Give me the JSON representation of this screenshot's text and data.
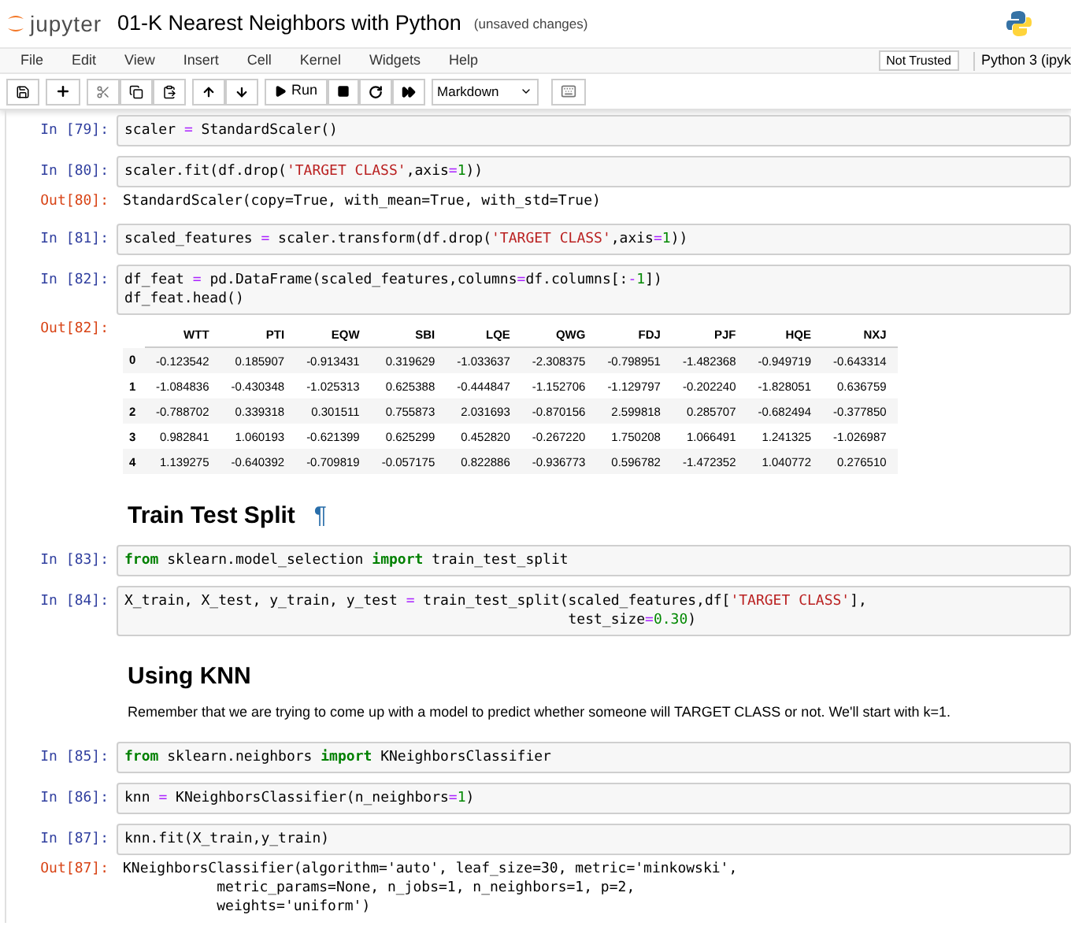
{
  "header": {
    "logo_text": "jupyter",
    "title": "01-K Nearest Neighbors with Python",
    "status": "(unsaved changes)"
  },
  "menu": {
    "items": [
      "File",
      "Edit",
      "View",
      "Insert",
      "Cell",
      "Kernel",
      "Widgets",
      "Help"
    ],
    "trust": "Not Trusted",
    "kernel": "Python 3 (ipyk"
  },
  "toolbar": {
    "run_label": "Run",
    "cell_type": "Markdown"
  },
  "cells": [
    {
      "kind": "code",
      "prompt": "In [79]:",
      "lines": [
        [
          {
            "kind": "plain",
            "t": "scaler "
          },
          {
            "kind": "operator",
            "t": "="
          },
          {
            "kind": "plain",
            "t": " StandardScaler()"
          }
        ]
      ]
    },
    {
      "kind": "code",
      "prompt": "In [80]:",
      "lines": [
        [
          {
            "kind": "plain",
            "t": "scaler.fit(df.drop("
          },
          {
            "kind": "string",
            "t": "'TARGET CLASS'"
          },
          {
            "kind": "plain",
            "t": ",axis"
          },
          {
            "kind": "operator",
            "t": "="
          },
          {
            "kind": "number",
            "t": "1"
          },
          {
            "kind": "plain",
            "t": "))"
          }
        ]
      ]
    },
    {
      "kind": "output",
      "prompt": "Out[80]:",
      "lines": [
        "StandardScaler(copy=True, with_mean=True, with_std=True)"
      ]
    },
    {
      "kind": "code",
      "prompt": "In [81]:",
      "lines": [
        [
          {
            "kind": "plain",
            "t": "scaled_features "
          },
          {
            "kind": "operator",
            "t": "="
          },
          {
            "kind": "plain",
            "t": " scaler.transform(df.drop("
          },
          {
            "kind": "string",
            "t": "'TARGET CLASS'"
          },
          {
            "kind": "plain",
            "t": ",axis"
          },
          {
            "kind": "operator",
            "t": "="
          },
          {
            "kind": "number",
            "t": "1"
          },
          {
            "kind": "plain",
            "t": "))"
          }
        ]
      ]
    },
    {
      "kind": "code",
      "prompt": "In [82]:",
      "lines": [
        [
          {
            "kind": "plain",
            "t": "df_feat "
          },
          {
            "kind": "operator",
            "t": "="
          },
          {
            "kind": "plain",
            "t": " pd.DataFrame(scaled_features,columns"
          },
          {
            "kind": "operator",
            "t": "="
          },
          {
            "kind": "plain",
            "t": "df.columns[:"
          },
          {
            "kind": "operator",
            "t": "-"
          },
          {
            "kind": "number",
            "t": "1"
          },
          {
            "kind": "plain",
            "t": "])"
          }
        ],
        [
          {
            "kind": "plain",
            "t": "df_feat.head()"
          }
        ]
      ]
    },
    {
      "kind": "table",
      "prompt": "Out[82]:",
      "columns": [
        "WTT",
        "PTI",
        "EQW",
        "SBI",
        "LQE",
        "QWG",
        "FDJ",
        "PJF",
        "HQE",
        "NXJ"
      ],
      "rows": [
        {
          "index": "0",
          "cells": [
            "-0.123542",
            "0.185907",
            "-0.913431",
            "0.319629",
            "-1.033637",
            "-2.308375",
            "-0.798951",
            "-1.482368",
            "-0.949719",
            "-0.643314"
          ]
        },
        {
          "index": "1",
          "cells": [
            "-1.084836",
            "-0.430348",
            "-1.025313",
            "0.625388",
            "-0.444847",
            "-1.152706",
            "-1.129797",
            "-0.202240",
            "-1.828051",
            "0.636759"
          ]
        },
        {
          "index": "2",
          "cells": [
            "-0.788702",
            "0.339318",
            "0.301511",
            "0.755873",
            "2.031693",
            "-0.870156",
            "2.599818",
            "0.285707",
            "-0.682494",
            "-0.377850"
          ]
        },
        {
          "index": "3",
          "cells": [
            "0.982841",
            "1.060193",
            "-0.621399",
            "0.625299",
            "0.452820",
            "-0.267220",
            "1.750208",
            "1.066491",
            "1.241325",
            "-1.026987"
          ]
        },
        {
          "index": "4",
          "cells": [
            "1.139275",
            "-0.640392",
            "-0.709819",
            "-0.057175",
            "0.822886",
            "-0.936773",
            "0.596782",
            "-1.472352",
            "1.040772",
            "0.276510"
          ]
        }
      ]
    },
    {
      "kind": "heading",
      "text": "Train Test Split",
      "anchor": "¶"
    },
    {
      "kind": "code",
      "prompt": "In [83]:",
      "lines": [
        [
          {
            "kind": "keyword",
            "t": "from"
          },
          {
            "kind": "plain",
            "t": " sklearn.model_selection "
          },
          {
            "kind": "keyword",
            "t": "import"
          },
          {
            "kind": "plain",
            "t": " train_test_split"
          }
        ]
      ]
    },
    {
      "kind": "code",
      "prompt": "In [84]:",
      "lines": [
        [
          {
            "kind": "plain",
            "t": "X_train, X_test, y_train, y_test "
          },
          {
            "kind": "operator",
            "t": "="
          },
          {
            "kind": "plain",
            "t": " train_test_split(scaled_features,df["
          },
          {
            "kind": "string",
            "t": "'TARGET CLASS'"
          },
          {
            "kind": "plain",
            "t": "],"
          }
        ],
        [
          {
            "kind": "plain",
            "t": "                                                    test_size"
          },
          {
            "kind": "operator",
            "t": "="
          },
          {
            "kind": "number",
            "t": "0.30"
          },
          {
            "kind": "plain",
            "t": ")"
          }
        ]
      ]
    },
    {
      "kind": "heading",
      "text": "Using KNN"
    },
    {
      "kind": "text",
      "text": "Remember that we are trying to come up with a model to predict whether someone will TARGET CLASS or not. We'll start with k=1."
    },
    {
      "kind": "code",
      "prompt": "In [85]:",
      "lines": [
        [
          {
            "kind": "keyword",
            "t": "from"
          },
          {
            "kind": "plain",
            "t": " sklearn.neighbors "
          },
          {
            "kind": "keyword",
            "t": "import"
          },
          {
            "kind": "plain",
            "t": " KNeighborsClassifier"
          }
        ]
      ]
    },
    {
      "kind": "code",
      "prompt": "In [86]:",
      "lines": [
        [
          {
            "kind": "plain",
            "t": "knn "
          },
          {
            "kind": "operator",
            "t": "="
          },
          {
            "kind": "plain",
            "t": " KNeighborsClassifier(n_neighbors"
          },
          {
            "kind": "operator",
            "t": "="
          },
          {
            "kind": "number",
            "t": "1"
          },
          {
            "kind": "plain",
            "t": ")"
          }
        ]
      ]
    },
    {
      "kind": "code",
      "prompt": "In [87]:",
      "lines": [
        [
          {
            "kind": "plain",
            "t": "knn.fit(X_train,y_train)"
          }
        ]
      ]
    },
    {
      "kind": "output",
      "prompt": "Out[87]:",
      "lines": [
        "KNeighborsClassifier(algorithm='auto', leaf_size=30, metric='minkowski',",
        "           metric_params=None, n_jobs=1, n_neighbors=1, p=2,",
        "           weights='uniform')"
      ]
    }
  ]
}
